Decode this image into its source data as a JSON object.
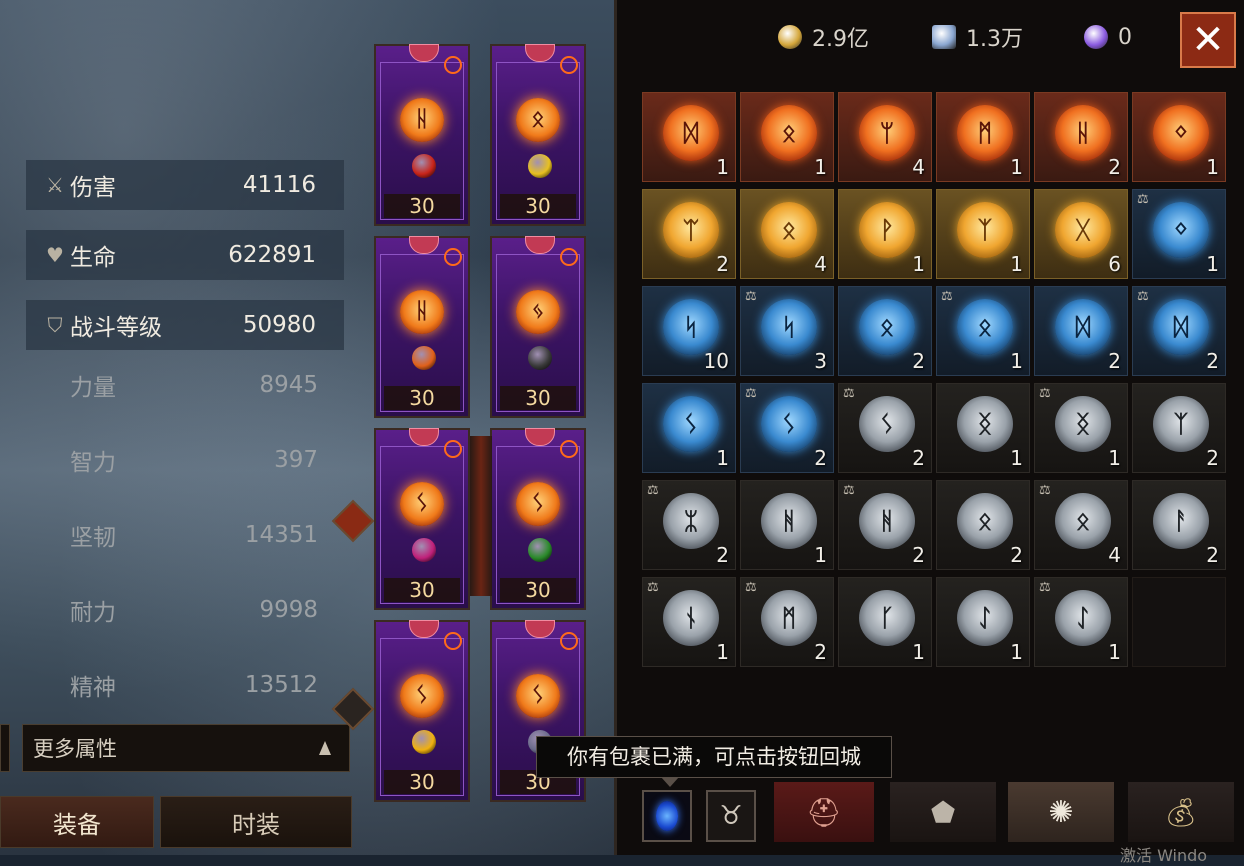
{
  "currencies": [
    {
      "icon": "gold-coin-icon",
      "value": "2.9亿",
      "color": "#d4a63a"
    },
    {
      "icon": "scroll-icon",
      "value": "1.3万",
      "color": "#8aa6d0"
    },
    {
      "icon": "purple-gem-icon",
      "value": "0",
      "color": "#8a5ae0"
    }
  ],
  "main_stats": [
    {
      "icon": "sword-icon",
      "label": "伤害",
      "value": "41116"
    },
    {
      "icon": "heart-icon",
      "label": "生命",
      "value": "622891"
    },
    {
      "icon": "shield-icon",
      "label": "战斗等级",
      "value": "50980"
    }
  ],
  "sub_stats": [
    {
      "label": "力量",
      "value": "8945"
    },
    {
      "label": "智力",
      "value": "397"
    },
    {
      "label": "坚韧",
      "value": "14351"
    },
    {
      "label": "耐力",
      "value": "9998"
    },
    {
      "label": "精神",
      "value": "13512"
    }
  ],
  "more_attributes": "更多属性",
  "bottom_tabs": {
    "equipment": "装备",
    "fashion": "时装"
  },
  "equipment_slots": [
    {
      "level": "30",
      "rune": "ᚺ",
      "gem": "#c8241a"
    },
    {
      "level": "30",
      "rune": "ᛟ",
      "gem": "#e8c020"
    },
    {
      "level": "30",
      "rune": "ᚺ",
      "gem": "#e0601a"
    },
    {
      "level": "30",
      "rune": "ᛃ",
      "gem": "#3a3a3a"
    },
    {
      "level": "30",
      "rune": "ᛊ",
      "gem": "#c0207a"
    },
    {
      "level": "30",
      "rune": "ᛊ",
      "gem": "#2a8a2a"
    },
    {
      "level": "30",
      "rune": "ᛊ",
      "gem": "#f0b010"
    },
    {
      "level": "30",
      "rune": "ᛊ",
      "gem": "#6a6a8a"
    }
  ],
  "runes": [
    {
      "tier": "red",
      "glyph": "ᛞ",
      "count": "1",
      "locked": false
    },
    {
      "tier": "red",
      "glyph": "ᛟ",
      "count": "1",
      "locked": false
    },
    {
      "tier": "red",
      "glyph": "ᛘ",
      "count": "4",
      "locked": false
    },
    {
      "tier": "red",
      "glyph": "ᛗ",
      "count": "1",
      "locked": false
    },
    {
      "tier": "red",
      "glyph": "ᚺ",
      "count": "2",
      "locked": false
    },
    {
      "tier": "red",
      "glyph": "ᛜ",
      "count": "1",
      "locked": false
    },
    {
      "tier": "gold",
      "glyph": "ᛠ",
      "count": "2",
      "locked": false
    },
    {
      "tier": "gold",
      "glyph": "ᛟ",
      "count": "4",
      "locked": false
    },
    {
      "tier": "gold",
      "glyph": "ᚹ",
      "count": "1",
      "locked": false
    },
    {
      "tier": "gold",
      "glyph": "ᛉ",
      "count": "1",
      "locked": false
    },
    {
      "tier": "gold",
      "glyph": "ᚷ",
      "count": "6",
      "locked": false
    },
    {
      "tier": "blue",
      "glyph": "ᛜ",
      "count": "1",
      "locked": true
    },
    {
      "tier": "blue",
      "glyph": "ᛋ",
      "count": "10",
      "locked": false
    },
    {
      "tier": "blue",
      "glyph": "ᛋ",
      "count": "3",
      "locked": true
    },
    {
      "tier": "blue",
      "glyph": "ᛟ",
      "count": "2",
      "locked": false
    },
    {
      "tier": "blue",
      "glyph": "ᛟ",
      "count": "1",
      "locked": true
    },
    {
      "tier": "blue",
      "glyph": "ᛞ",
      "count": "2",
      "locked": false
    },
    {
      "tier": "blue",
      "glyph": "ᛞ",
      "count": "2",
      "locked": true
    },
    {
      "tier": "blue",
      "glyph": "ᛊ",
      "count": "1",
      "locked": false
    },
    {
      "tier": "blue",
      "glyph": "ᛊ",
      "count": "2",
      "locked": true
    },
    {
      "tier": "grey",
      "glyph": "ᛊ",
      "count": "2",
      "locked": true
    },
    {
      "tier": "grey",
      "glyph": "ᛝ",
      "count": "1",
      "locked": false
    },
    {
      "tier": "grey",
      "glyph": "ᛝ",
      "count": "1",
      "locked": true
    },
    {
      "tier": "grey",
      "glyph": "ᛉ",
      "count": "2",
      "locked": false
    },
    {
      "tier": "grey",
      "glyph": "ᛯ",
      "count": "2",
      "locked": true
    },
    {
      "tier": "grey",
      "glyph": "ᚻ",
      "count": "1",
      "locked": false
    },
    {
      "tier": "grey",
      "glyph": "ᚻ",
      "count": "2",
      "locked": true
    },
    {
      "tier": "grey",
      "glyph": "ᛟ",
      "count": "2",
      "locked": false
    },
    {
      "tier": "grey",
      "glyph": "ᛟ",
      "count": "4",
      "locked": true
    },
    {
      "tier": "grey",
      "glyph": "ᚨ",
      "count": "2",
      "locked": false
    },
    {
      "tier": "grey",
      "glyph": "ᚾ",
      "count": "1",
      "locked": true
    },
    {
      "tier": "grey",
      "glyph": "ᛗ",
      "count": "2",
      "locked": true
    },
    {
      "tier": "grey",
      "glyph": "ᚴ",
      "count": "1",
      "locked": false
    },
    {
      "tier": "grey",
      "glyph": "ᛇ",
      "count": "1",
      "locked": false
    },
    {
      "tier": "grey",
      "glyph": "ᛇ",
      "count": "1",
      "locked": true
    }
  ],
  "tooltip": "你有包裹已满，可点击按钮回城",
  "watermark": "激活 Windo"
}
